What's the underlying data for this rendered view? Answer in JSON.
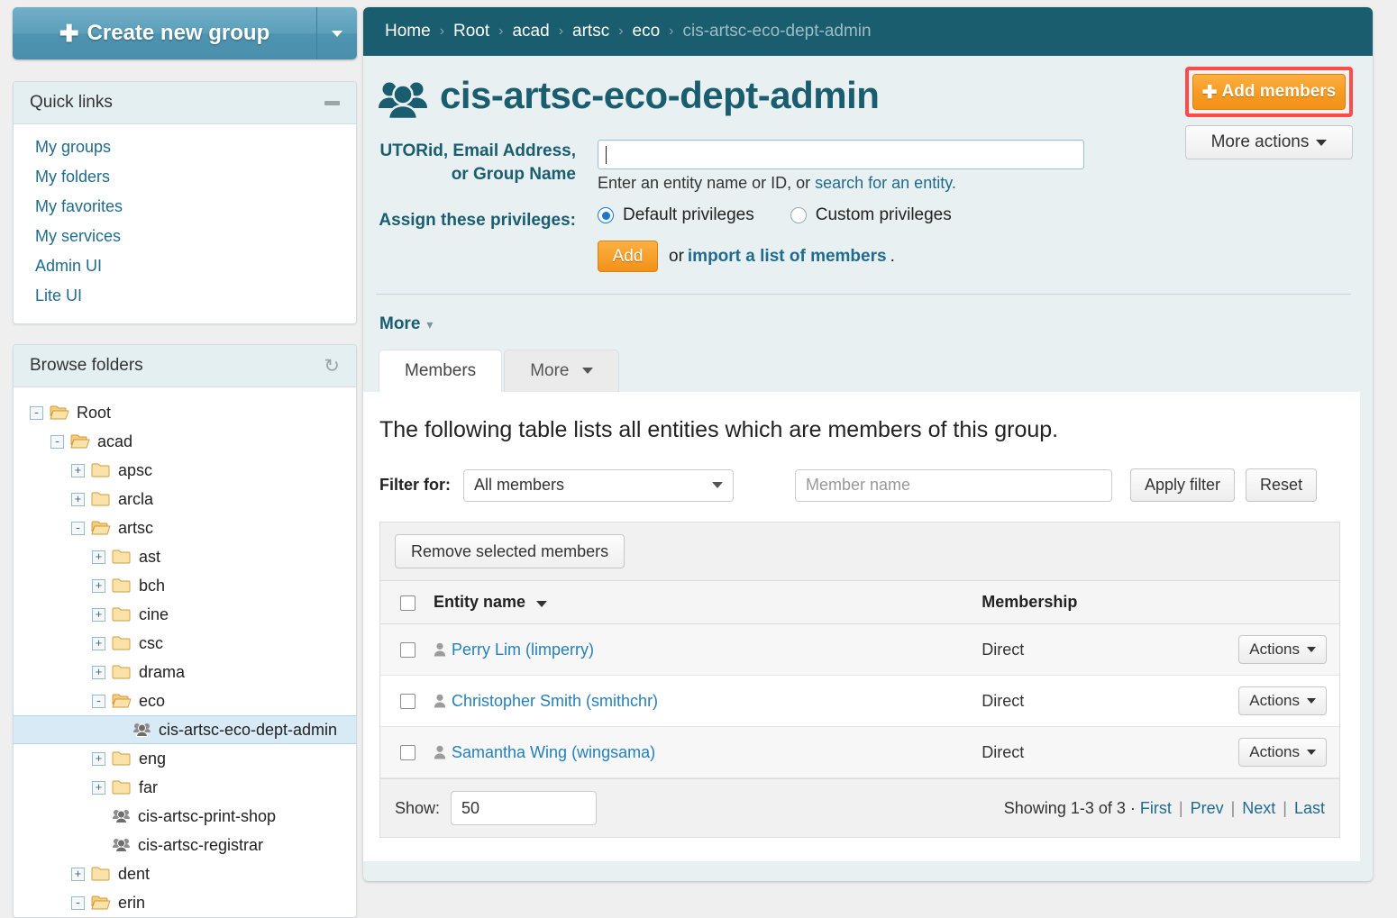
{
  "sidebar": {
    "create_button": {
      "label": "Create new group",
      "icon": "plus-icon"
    },
    "quick_links": {
      "title": "Quick links",
      "collapse_icon": "minus-icon",
      "items": [
        {
          "label": "My groups"
        },
        {
          "label": "My folders"
        },
        {
          "label": "My favorites"
        },
        {
          "label": "My services"
        },
        {
          "label": "Admin UI"
        },
        {
          "label": "Lite UI"
        }
      ]
    },
    "browse_folders": {
      "title": "Browse folders",
      "refresh_icon": "refresh-icon",
      "tree": [
        {
          "label": "Root",
          "depth": 0,
          "toggle": "-",
          "type": "folder-open",
          "selected": false
        },
        {
          "label": "acad",
          "depth": 1,
          "toggle": "-",
          "type": "folder-open",
          "selected": false
        },
        {
          "label": "apsc",
          "depth": 2,
          "toggle": "+",
          "type": "folder-closed",
          "selected": false
        },
        {
          "label": "arcla",
          "depth": 2,
          "toggle": "+",
          "type": "folder-closed",
          "selected": false
        },
        {
          "label": "artsc",
          "depth": 2,
          "toggle": "-",
          "type": "folder-open",
          "selected": false
        },
        {
          "label": "ast",
          "depth": 3,
          "toggle": "+",
          "type": "folder-closed",
          "selected": false
        },
        {
          "label": "bch",
          "depth": 3,
          "toggle": "+",
          "type": "folder-closed",
          "selected": false
        },
        {
          "label": "cine",
          "depth": 3,
          "toggle": "+",
          "type": "folder-closed",
          "selected": false
        },
        {
          "label": "csc",
          "depth": 3,
          "toggle": "+",
          "type": "folder-closed",
          "selected": false
        },
        {
          "label": "drama",
          "depth": 3,
          "toggle": "+",
          "type": "folder-closed",
          "selected": false
        },
        {
          "label": "eco",
          "depth": 3,
          "toggle": "-",
          "type": "folder-open",
          "selected": false
        },
        {
          "label": "cis-artsc-eco-dept-admin",
          "depth": 4,
          "toggle": "",
          "type": "group",
          "selected": true
        },
        {
          "label": "eng",
          "depth": 3,
          "toggle": "+",
          "type": "folder-closed",
          "selected": false
        },
        {
          "label": "far",
          "depth": 3,
          "toggle": "+",
          "type": "folder-closed",
          "selected": false
        },
        {
          "label": "cis-artsc-print-shop",
          "depth": 3,
          "toggle": "",
          "type": "group",
          "selected": false
        },
        {
          "label": "cis-artsc-registrar",
          "depth": 3,
          "toggle": "",
          "type": "group",
          "selected": false
        },
        {
          "label": "dent",
          "depth": 2,
          "toggle": "+",
          "type": "folder-closed",
          "selected": false
        },
        {
          "label": "erin",
          "depth": 2,
          "toggle": "-",
          "type": "folder-open",
          "selected": false
        }
      ]
    }
  },
  "breadcrumb": {
    "items": [
      "Home",
      "Root",
      "acad",
      "artsc",
      "eco"
    ],
    "current": "cis-artsc-eco-dept-admin",
    "separator": "›"
  },
  "header": {
    "group_icon": "group-icon",
    "title": "cis-artsc-eco-dept-admin",
    "add_members_label": "Add members",
    "add_members_icon": "plus-icon",
    "more_actions_label": "More actions",
    "highlight_color": "#fd4b4b"
  },
  "add_form": {
    "entity_label_line1": "UTORid, Email Address,",
    "entity_label_line2": "or Group Name",
    "entity_value": "",
    "help_text_prefix": "Enter an entity name or ID, or ",
    "help_link": "search for an entity.",
    "privileges_label": "Assign these privileges:",
    "privilege_options": [
      {
        "label": "Default privileges",
        "selected": true
      },
      {
        "label": "Custom privileges",
        "selected": false
      }
    ],
    "add_button": "Add",
    "or_text": "or",
    "import_link": "import a list of members",
    "period": "."
  },
  "more_section": {
    "label": "More",
    "chevron": "chevron-down-icon"
  },
  "tabs": [
    {
      "label": "Members",
      "active": true
    },
    {
      "label": "More",
      "active": false,
      "has_caret": true
    }
  ],
  "members_panel": {
    "description": "The following table lists all entities which are members of this group.",
    "filter_label": "Filter for:",
    "filter_select_value": "All members",
    "member_name_placeholder": "Member name",
    "apply_filter_label": "Apply filter",
    "reset_label": "Reset",
    "remove_selected_label": "Remove selected members",
    "columns": [
      "Entity name",
      "Membership"
    ],
    "sort_column": "Entity name",
    "rows": [
      {
        "name": "Perry Lim (limperry)",
        "membership": "Direct",
        "actions_label": "Actions"
      },
      {
        "name": "Christopher Smith (smithchr)",
        "membership": "Direct",
        "actions_label": "Actions"
      },
      {
        "name": "Samantha Wing (wingsama)",
        "membership": "Direct",
        "actions_label": "Actions"
      }
    ],
    "show_label": "Show:",
    "show_value": "50",
    "showing_text": "Showing 1-3 of 3",
    "pager": {
      "dot": "·",
      "first": "First",
      "prev": "Prev",
      "next": "Next",
      "last": "Last"
    }
  }
}
